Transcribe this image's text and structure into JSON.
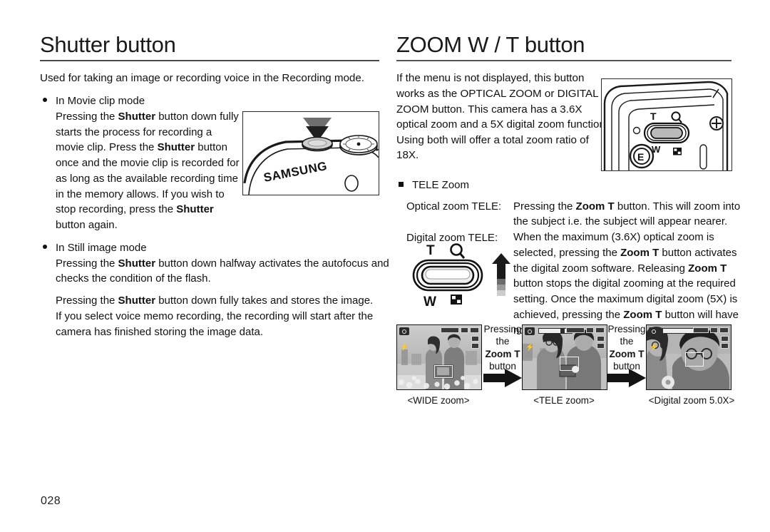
{
  "page": {
    "number": "028"
  },
  "left": {
    "heading": "Shutter button",
    "lead": "Used for taking an image or recording voice in the Recording mode.",
    "movie": {
      "title": "In Movie clip mode",
      "body_1": "Pressing the ",
      "bold_1": "Shutter",
      "body_2": " button down fully starts the process for recording a movie clip. Press the ",
      "bold_2": "Shutter",
      "body_3": " button once and the movie clip is recorded for as long as the available recording time in the memory allows. If you wish to stop recording, press the ",
      "bold_3": "Shutter",
      "body_4": " button again."
    },
    "still": {
      "title": "In Still image mode",
      "p1_a": "Pressing the ",
      "p1_bold": "Shutter",
      "p1_b": " button down halfway activates the autofocus and checks the condition of the flash.",
      "p2_a": "Pressing the ",
      "p2_bold": "Shutter",
      "p2_b": " button down fully takes and stores the image.",
      "p3": "If you select voice memo recording, the recording will start after the camera has finished storing the image data."
    },
    "illustration_label": "camera-top-shutter-diagram",
    "brand": "SAMSUNG"
  },
  "right": {
    "heading": "ZOOM W / T button",
    "intro": "If the menu is not displayed, this button works as the OPTICAL ZOOM or DIGITAL ZOOM button. This camera has a 3.6X optical zoom and a 5X digital zoom function. Using both will offer a total zoom ratio of 18X.",
    "tele_zoom_title": "TELE Zoom",
    "optical_label": "Optical zoom TELE:",
    "optical_text_a": "Pressing the ",
    "optical_bold": "Zoom T",
    "optical_text_b": " button. This will zoom into the subject i.e. the subject will appear nearer.",
    "digital_label": "Digital zoom TELE:",
    "digital_line1_a": "When the maximum (3.6X) optical zoom is selected, pressing the ",
    "digital_bold_1": "Zoom T",
    "digital_line1_b": " button activates the digital zoom software. Releasing ",
    "digital_bold_2": "Zoom T",
    "digital_line1_c": " button stops the digital zooming at the required setting. Once the maximum digital zoom (5X) is achieved, pressing the ",
    "digital_bold_3": "Zoom T",
    "digital_line1_d": " button will have no effect.",
    "lever": {
      "tele": "T",
      "wide": "W",
      "magnify_icon": "magnifier-icon",
      "thumbnail_icon": "thumbnail-grid-icon"
    },
    "camera_lever": {
      "tele": "T",
      "wide": "W",
      "mode_e": "E",
      "magnify_icon": "magnifier-icon",
      "thumbnail_icon": "thumbnail-grid-icon"
    }
  },
  "sequence": {
    "steps": [
      {
        "caption": "<WIDE zoom>",
        "zoom_readout": "",
        "name": "wide-zoom-screenshot"
      },
      {
        "caption": "<TELE zoom>",
        "zoom_readout": "",
        "name": "tele-zoom-screenshot"
      },
      {
        "caption": "<Digital zoom 5.0X>",
        "zoom_readout": "5.0",
        "name": "digital-zoom-screenshot"
      }
    ],
    "transitions": [
      {
        "line1": "Pressing",
        "line2": "the",
        "line3": "Zoom T",
        "line4": "button"
      },
      {
        "line1": "Pressing",
        "line2": "the",
        "line3": "Zoom T",
        "line4": "button"
      }
    ]
  },
  "colors": {
    "ink": "#111111",
    "rule": "#4a4a4a",
    "paper": "#ffffff"
  }
}
